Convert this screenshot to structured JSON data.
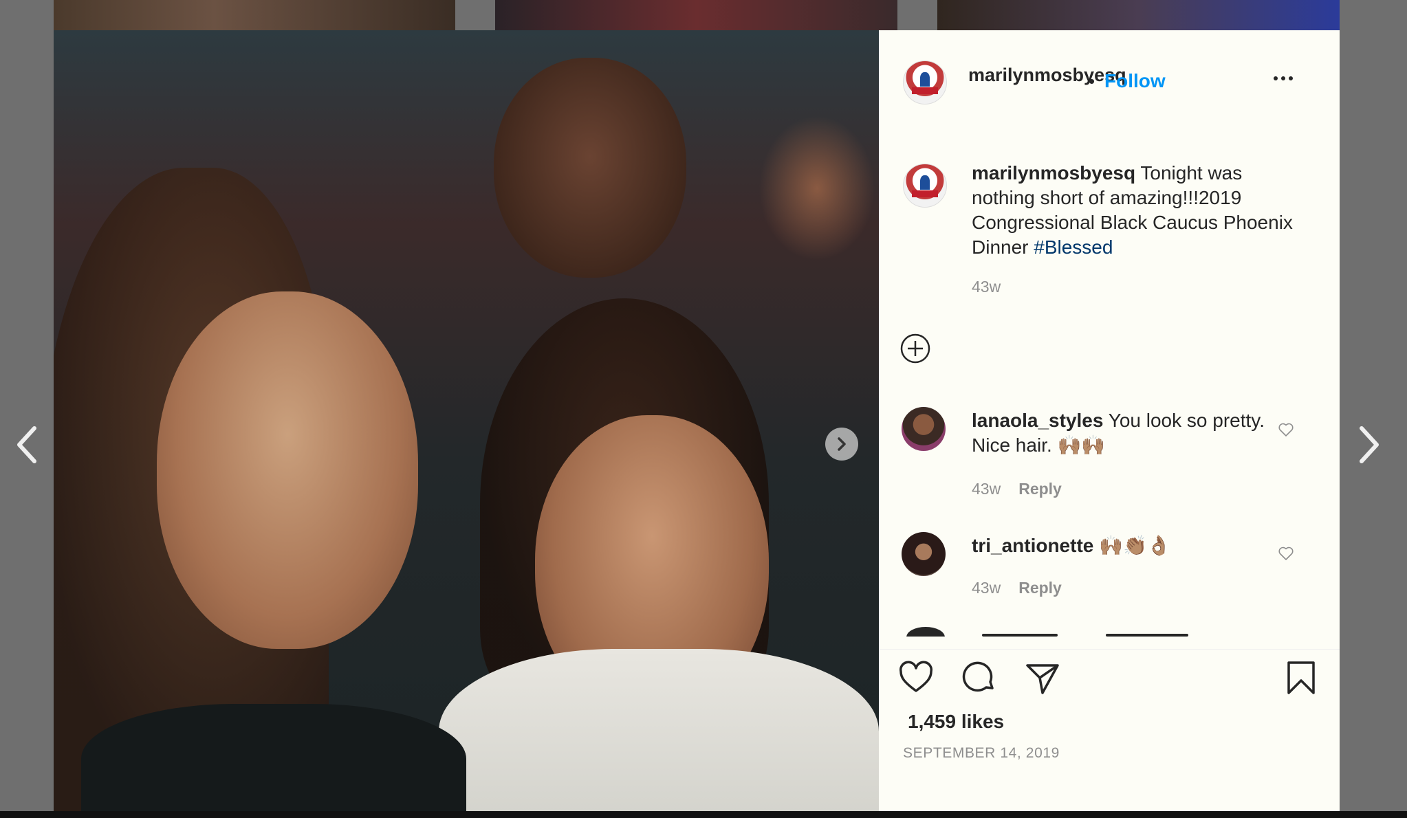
{
  "post": {
    "username": "marilynmosbyesq",
    "follow_label": "Follow",
    "bullet": "•",
    "caption": {
      "username": "marilynmosbyesq",
      "text": " Tonight was nothing short of amazing!!!2019 Congressional Black Caucus Phoenix Dinner ",
      "hashtag": "#Blessed",
      "time": "43w"
    },
    "comments": [
      {
        "username": "lanaola_styles",
        "text": " You look so pretty. Nice hair. 🙌🏽🙌🏽",
        "time": "43w",
        "reply": "Reply"
      },
      {
        "username": "tri_antionette",
        "text": " 🙌🏽👏🏽👌🏽",
        "time": "43w",
        "reply": "Reply"
      }
    ],
    "likes": "1,459 likes",
    "date": "SEPTEMBER 14, 2019"
  },
  "icons": {
    "prev": "chevron-left-icon",
    "next": "chevron-right-icon",
    "carousel_next": "carousel-next-icon",
    "more": "more-options-icon",
    "add": "add-icon",
    "like": "heart-icon",
    "comment": "comment-icon",
    "share": "share-icon",
    "save": "bookmark-icon"
  },
  "colors": {
    "accent": "#0095f6",
    "hashtag": "#00376b",
    "muted": "#8e8e8e",
    "text": "#262626"
  }
}
